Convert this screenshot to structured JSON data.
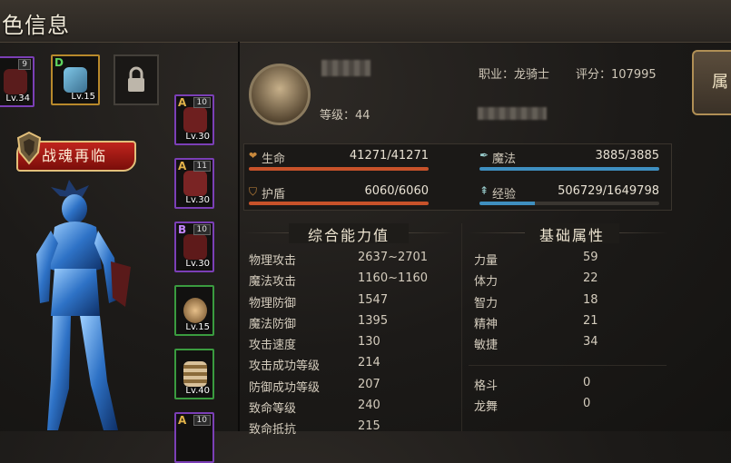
{
  "header": {
    "title": "色信息"
  },
  "side_tab": {
    "label": "属"
  },
  "equipment": {
    "top": [
      {
        "level": "Lv.34",
        "count": "9",
        "grade": ""
      },
      {
        "level": "Lv.15",
        "count": "",
        "grade": "D"
      }
    ],
    "column": [
      {
        "level": "Lv.30",
        "count": "10",
        "grade": "A"
      },
      {
        "level": "Lv.30",
        "count": "11",
        "grade": "A"
      },
      {
        "level": "Lv.30",
        "count": "10",
        "grade": "B"
      },
      {
        "level": "Lv.15",
        "count": "",
        "grade": ""
      },
      {
        "level": "Lv.40",
        "count": "",
        "grade": ""
      },
      {
        "level": "",
        "count": "10",
        "grade": "A"
      }
    ]
  },
  "banner": {
    "text": "战魂再临"
  },
  "profile": {
    "job_label": "职业：龙骑士",
    "score_label": "评分：107995",
    "level_label": "等级：44"
  },
  "vitals": {
    "hp": {
      "label": "生命",
      "value": "41271/41271",
      "fraction": 1.0,
      "color": "#c7522a"
    },
    "mp": {
      "label": "魔法",
      "value": "3885/3885",
      "fraction": 1.0,
      "color": "#3f8fc0"
    },
    "shield": {
      "label": "护盾",
      "value": "6060/6060",
      "fraction": 1.0,
      "color": "#c7522a"
    },
    "exp": {
      "label": "经验",
      "value": "506729/1649798",
      "fraction": 0.307,
      "color": "#3f8fc0"
    }
  },
  "combat": {
    "title": "综合能力值",
    "rows": [
      {
        "name": "物理攻击",
        "value": "2637~2701"
      },
      {
        "name": "魔法攻击",
        "value": "1160~1160"
      },
      {
        "name": "物理防御",
        "value": "1547"
      },
      {
        "name": "魔法防御",
        "value": "1395"
      },
      {
        "name": "攻击速度",
        "value": "130"
      },
      {
        "name": "攻击成功等级",
        "value": "214"
      },
      {
        "name": "防御成功等级",
        "value": "207"
      },
      {
        "name": "致命等级",
        "value": "240"
      },
      {
        "name": "致命抵抗",
        "value": "215"
      }
    ]
  },
  "basic": {
    "title": "基础属性",
    "rows": [
      {
        "name": "力量",
        "value": "59"
      },
      {
        "name": "体力",
        "value": "22"
      },
      {
        "name": "智力",
        "value": "18"
      },
      {
        "name": "精神",
        "value": "21"
      },
      {
        "name": "敏捷",
        "value": "34"
      }
    ],
    "extra": [
      {
        "name": "格斗",
        "value": "0"
      },
      {
        "name": "龙舞",
        "value": "0"
      }
    ]
  }
}
